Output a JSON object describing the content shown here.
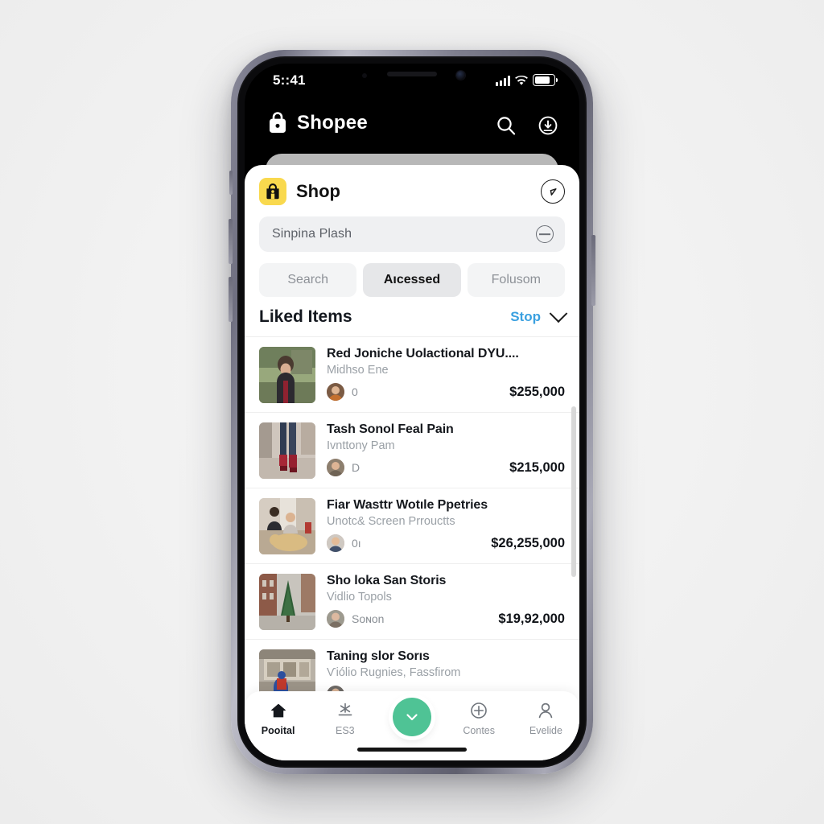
{
  "status_bar": {
    "time": "5::41",
    "icons": [
      "signal-bars-icon",
      "wifi-icon",
      "battery-icon"
    ]
  },
  "app_bar": {
    "brand": "Shopee",
    "brand_icon": "shopping-bag-icon",
    "actions": [
      {
        "name": "search-icon",
        "label": "Search"
      },
      {
        "name": "download-circle-icon",
        "label": "Downloads"
      }
    ]
  },
  "sheet": {
    "badge_icon": "shopping-bag-icon",
    "badge_color": "#F9D94E",
    "title": "Shop",
    "action_icon": "compass-circle-icon",
    "search": {
      "value": "Sinpina Plash",
      "placeholder": "Sinpina Plash",
      "clear_icon": "minus-circle-icon"
    },
    "segments": [
      {
        "label": "Search",
        "active": false
      },
      {
        "label": "Aıcessed",
        "active": true
      },
      {
        "label": "Folusom",
        "active": false
      }
    ],
    "section": {
      "title": "Liked Items",
      "link": "Stop",
      "link_color": "#3AA0E0",
      "chevron_icon": "chevron-down-icon"
    },
    "items": [
      {
        "title": "Red Joniche Uolactional DYU....",
        "subtitle": "Midhso Ene",
        "seller": "0",
        "price": "$255,000",
        "thumb": "woman-in-park-photo"
      },
      {
        "title": "Tash Sonol Feal Pain",
        "subtitle": "Ivnttony Pam",
        "seller": "D",
        "price": "$215,000",
        "thumb": "red-boots-photo"
      },
      {
        "title": "Fiar Wasttr Wotıle Рpetries",
        "subtitle": "Unotc& Screen Prrouctts",
        "seller": "0ı",
        "price": "$26,255,000",
        "thumb": "people-with-dog-photo"
      },
      {
        "title": "Sho loka San Storis",
        "subtitle": "Vidlio Topols",
        "seller": "Soɴon",
        "price": "$19,92,000",
        "thumb": "street-with-tree-photo"
      },
      {
        "title": "Taning slor Sorıs",
        "subtitle": "Ѵiólio Rugnies, Fassfirom",
        "seller": "",
        "price": "",
        "thumb": "storefront-photo"
      }
    ]
  },
  "tab_bar": {
    "items": [
      {
        "label": "Pooital",
        "icon": "home-icon",
        "active": true
      },
      {
        "label": "ES3",
        "icon": "asterisk-underline-icon",
        "active": false
      },
      {
        "label": "",
        "icon": "chevron-down-fab-icon",
        "active": false,
        "fab": true,
        "color": "#4FC395"
      },
      {
        "label": "Contes",
        "icon": "plus-circle-icon",
        "active": false
      },
      {
        "label": "Evelide",
        "icon": "person-icon",
        "active": false
      }
    ],
    "home_indicator": "home-indicator"
  }
}
